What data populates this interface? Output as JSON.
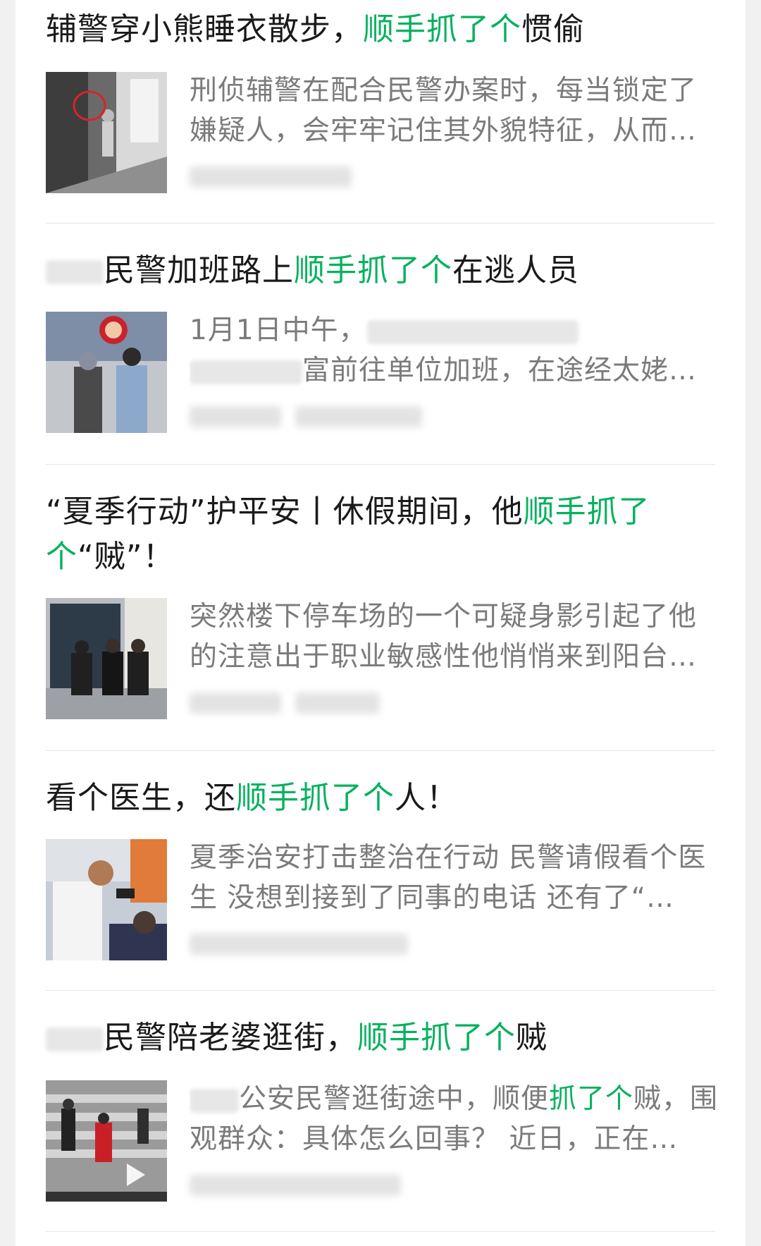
{
  "articles": [
    {
      "title_pre": "辅警穿小熊睡衣散步，",
      "title_hl": "顺手抓了个",
      "title_post": "惯偷",
      "desc": "刑侦辅警在配合民警办案时，每当锁定了嫌疑人，会牢牢记住其外貌特征，从而…"
    },
    {
      "title_pre": "民警加班路上",
      "title_hl": "顺手抓了个",
      "title_post": "在逃人员",
      "desc_line1": "1月1日中午，",
      "desc_line2": "富前往单位加班，在途经太姥…"
    },
    {
      "title_pre": "“夏季行动”护平安丨休假期间，他",
      "title_hl1": "顺手抓了",
      "title_hl2": "个",
      "title_post": "“贼”！",
      "desc": "突然楼下停车场的一个可疑身影引起了他的注意出于职业敏感性他悄悄来到阳台…"
    },
    {
      "title_pre": "看个医生，还",
      "title_hl": "顺手抓了个",
      "title_post": "人！",
      "desc": "夏季治安打击整治在行动 民警请假看个医生 没想到接到了同事的电话 还有了“…"
    },
    {
      "title_pre": "民警陪老婆逛街，",
      "title_hl": "顺手抓了个",
      "title_post": "贼",
      "desc_pre": "公安民警逛街途中，顺便",
      "desc_hl": "抓了个",
      "desc_post": "贼，围观群众：具体怎么回事？ 近日，正在…"
    }
  ],
  "colors": {
    "highlight": "#07b15f",
    "title": "#1a1a1a",
    "desc": "#7b7b7b"
  }
}
